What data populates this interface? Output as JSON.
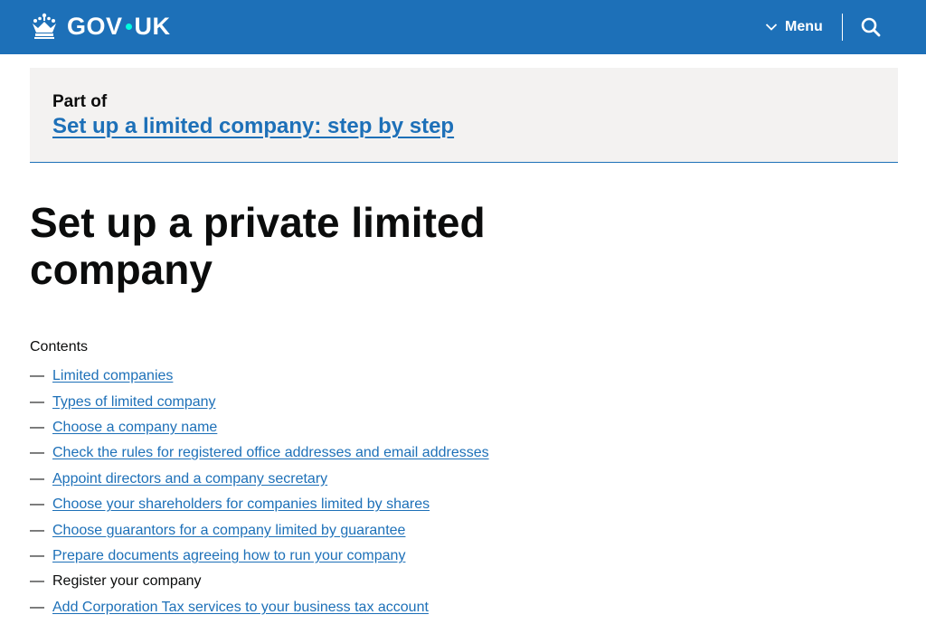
{
  "header": {
    "logo_text_left": "GOV",
    "logo_text_right": "UK",
    "menu_label": "Menu",
    "crown_icon": "crown-icon",
    "search_icon": "search-icon",
    "chevron_icon": "chevron-down-icon"
  },
  "part_of": {
    "label": "Part of",
    "link_text": "Set up a limited company: step by step"
  },
  "page": {
    "title": "Set up a private limited company"
  },
  "contents": {
    "heading": "Contents",
    "items": [
      {
        "label": "Limited companies",
        "current": false
      },
      {
        "label": "Types of limited company",
        "current": false
      },
      {
        "label": "Choose a company name",
        "current": false
      },
      {
        "label": "Check the rules for registered office addresses and email addresses",
        "current": false
      },
      {
        "label": "Appoint directors and a company secretary",
        "current": false
      },
      {
        "label": "Choose your shareholders for companies limited by shares",
        "current": false
      },
      {
        "label": "Choose guarantors for a company limited by guarantee",
        "current": false
      },
      {
        "label": "Prepare documents agreeing how to run your company",
        "current": false
      },
      {
        "label": "Register your company",
        "current": true
      },
      {
        "label": "Add Corporation Tax services to your business tax account",
        "current": false
      }
    ],
    "dash": "—"
  },
  "colors": {
    "brand_blue": "#1d70b8",
    "text": "#0b0c0c",
    "banner_bg": "#f3f2f1",
    "logo_dot": "#00ffe0"
  }
}
